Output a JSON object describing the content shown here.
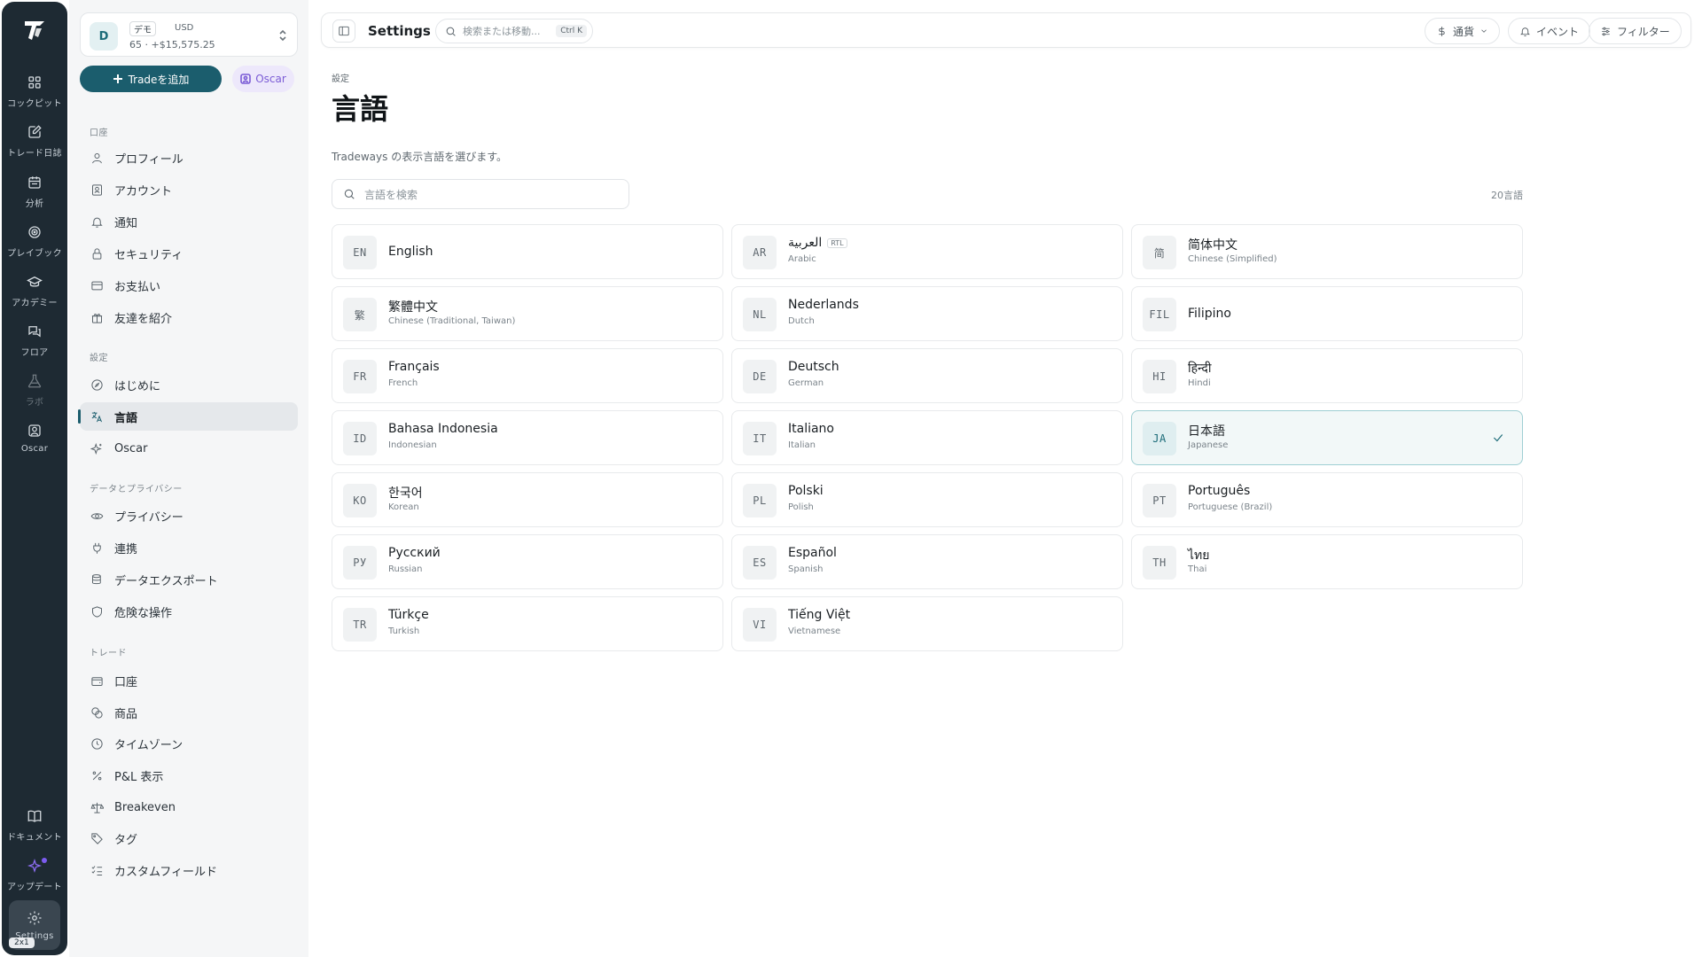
{
  "rail": {
    "items": [
      {
        "label": "コックピット",
        "icon": "grid-icon"
      },
      {
        "label": "トレード日誌",
        "icon": "journal-icon"
      },
      {
        "label": "分析",
        "icon": "calendar-icon"
      },
      {
        "label": "プレイブック",
        "icon": "target-icon"
      },
      {
        "label": "アカデミー",
        "icon": "graduation-cap-icon"
      },
      {
        "label": "フロア",
        "icon": "chat-icon"
      },
      {
        "label": "ラボ",
        "icon": "flask-icon"
      },
      {
        "label": "Oscar",
        "icon": "bot-icon"
      }
    ],
    "bottom": [
      {
        "label": "ドキュメント",
        "icon": "book-icon"
      },
      {
        "label": "アップデート",
        "icon": "sparkle-icon"
      },
      {
        "label": "Settings",
        "icon": "gear-icon"
      }
    ],
    "badge": "2x1",
    "update_dot_color": "#7c5cf0"
  },
  "account": {
    "avatar": "D",
    "tag": "デモ",
    "currency": "USD",
    "balance": "65 · +$15,575.25"
  },
  "actions": {
    "add_trade": "Tradeを追加",
    "oscar": "Oscar"
  },
  "sidebar": {
    "sections": [
      {
        "title": "口座",
        "items": [
          "プロフィール",
          "アカウント",
          "通知",
          "セキュリティ",
          "お支払い",
          "友達を紹介"
        ]
      },
      {
        "title": "設定",
        "items": [
          "はじめに",
          "言語",
          "Oscar"
        ]
      },
      {
        "title": "データとプライバシー",
        "items": [
          "プライバシー",
          "連携",
          "データエクスポート",
          "危険な操作"
        ]
      },
      {
        "title": "トレード",
        "items": [
          "口座",
          "商品",
          "タイムゾーン",
          "P&L 表示",
          "Breakeven",
          "タグ",
          "カスタムフィールド"
        ]
      }
    ],
    "active": "言語"
  },
  "topbar": {
    "title": "Settings",
    "search_placeholder": "検索または移動...",
    "shortcut": "Ctrl K",
    "currency": "通貨",
    "events": "イベント",
    "filter": "フィルター"
  },
  "page": {
    "breadcrumb": "設定",
    "title": "言語",
    "description": "Tradeways の表示言語を選びます。",
    "search_placeholder": "言語を検索",
    "count": "20言語"
  },
  "languages": [
    {
      "code": "EN",
      "name": "English",
      "english": ""
    },
    {
      "code": "AR",
      "name": "العربية",
      "english": "Arabic",
      "badge": "RTL"
    },
    {
      "code": "简",
      "name": "简体中文",
      "english": "Chinese (Simplified)"
    },
    {
      "code": "繁",
      "name": "繁體中文",
      "english": "Chinese (Traditional, Taiwan)"
    },
    {
      "code": "NL",
      "name": "Nederlands",
      "english": "Dutch"
    },
    {
      "code": "FIL",
      "name": "Filipino",
      "english": ""
    },
    {
      "code": "FR",
      "name": "Français",
      "english": "French"
    },
    {
      "code": "DE",
      "name": "Deutsch",
      "english": "German"
    },
    {
      "code": "HI",
      "name": "हिन्दी",
      "english": "Hindi"
    },
    {
      "code": "ID",
      "name": "Bahasa Indonesia",
      "english": "Indonesian"
    },
    {
      "code": "IT",
      "name": "Italiano",
      "english": "Italian"
    },
    {
      "code": "JA",
      "name": "日本語",
      "english": "Japanese",
      "selected": true
    },
    {
      "code": "KO",
      "name": "한국어",
      "english": "Korean"
    },
    {
      "code": "PL",
      "name": "Polski",
      "english": "Polish"
    },
    {
      "code": "PT",
      "name": "Português",
      "english": "Portuguese (Brazil)"
    },
    {
      "code": "РУ",
      "name": "Русский",
      "english": "Russian"
    },
    {
      "code": "ES",
      "name": "Español",
      "english": "Spanish"
    },
    {
      "code": "TH",
      "name": "ไทย",
      "english": "Thai"
    },
    {
      "code": "TR",
      "name": "Türkçe",
      "english": "Turkish"
    },
    {
      "code": "VI",
      "name": "Tiếng Việt",
      "english": "Vietnamese"
    }
  ],
  "colors": {
    "accent": "#1b5d6d",
    "rail": "#1e2a33",
    "oscar": "#7b5cd6"
  }
}
